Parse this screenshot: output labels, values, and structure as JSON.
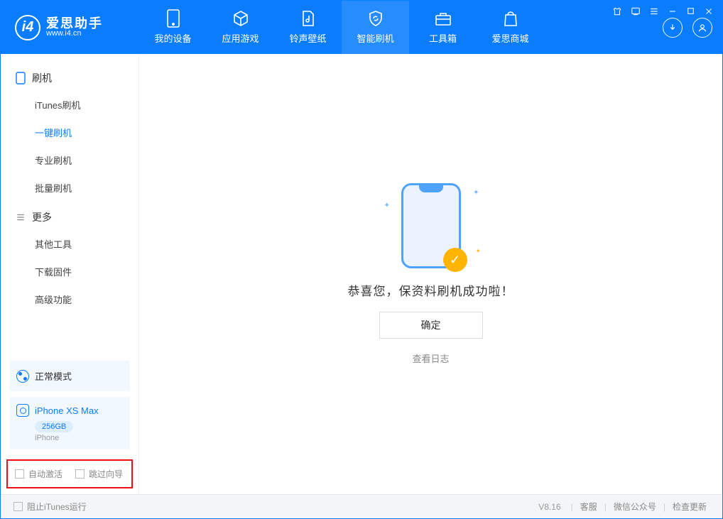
{
  "app": {
    "name_cn": "爱思助手",
    "name_en": "www.i4.cn"
  },
  "header_tabs": [
    {
      "label": "我的设备"
    },
    {
      "label": "应用游戏"
    },
    {
      "label": "铃声壁纸"
    },
    {
      "label": "智能刷机"
    },
    {
      "label": "工具箱"
    },
    {
      "label": "爱思商城"
    }
  ],
  "sidebar": {
    "section_flash": "刷机",
    "items_flash": [
      "iTunes刷机",
      "一键刷机",
      "专业刷机",
      "批量刷机"
    ],
    "section_more": "更多",
    "items_more": [
      "其他工具",
      "下载固件",
      "高级功能"
    ]
  },
  "mode": {
    "label": "正常模式"
  },
  "device": {
    "name": "iPhone XS Max",
    "storage": "256GB",
    "type": "iPhone"
  },
  "checks": {
    "auto_activate": "自动激活",
    "skip_guide": "跳过向导"
  },
  "result": {
    "message": "恭喜您，保资料刷机成功啦！",
    "ok": "确定",
    "viewlog": "查看日志"
  },
  "footer": {
    "block_itunes": "阻止iTunes运行",
    "version": "V8.16",
    "links": [
      "客服",
      "微信公众号",
      "检查更新"
    ]
  }
}
